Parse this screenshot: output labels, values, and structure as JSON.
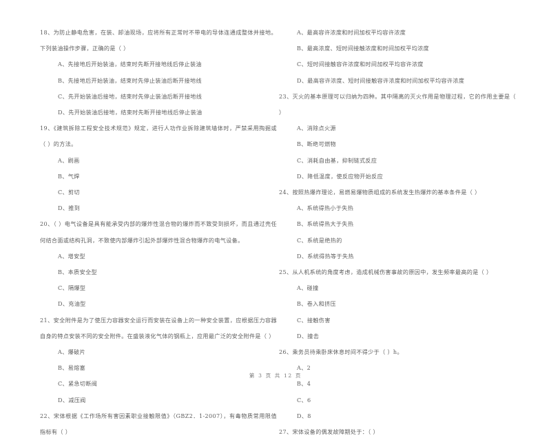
{
  "document": {
    "footer": "第 3 页 共 12 页",
    "page_number": 3,
    "total_pages": 12,
    "text_color": "#5e5e5e",
    "background_color": "#ffffff"
  },
  "left_column": {
    "questions": [
      {
        "number": "18",
        "stem": "18、为防止静电危害，在装、卸油现场，应将所有正常时不带电的导体连通成整体并接地。下列装油操作步骤，正确的是（      ）",
        "options": [
          "A、先接地后开始装油，结束时先断开接地线后停止装油",
          "B、先接地后开始装油，结束时先停止装油后断开接地线",
          "C、先开始装油后接地，结束时先停止装油后断开接地线",
          "D、先开始装油后接地，结束时先断开接地线后停止装油"
        ]
      },
      {
        "number": "19",
        "stem": "19、《建筑拆除工程安全技术规范》规定，进行人功作业拆除建筑墙体时，严禁采用掏掘或（      ）的方法。",
        "options": [
          "A、刷画",
          "B、气焊",
          "C、剪切",
          "D、推到"
        ]
      },
      {
        "number": "20",
        "stem": "20、（      ）电气设备是具有能承受内部的爆炸性混合物的爆炸而不致受到损坏，而且通过壳任何结合面或结构孔洞，不致使内部爆炸引起外部爆炸性混合物爆炸的电气设备。",
        "options": [
          "A、增安型",
          "B、本质安全型",
          "C、隔爆型",
          "D、充油型"
        ]
      },
      {
        "number": "21",
        "stem": "21、安全附件是为了使压力容器安全运行而安装在设备上的一种安全装置，应根据压力容器自身的特点安装不同的安全附件。在盛装液化气体的钢瓶上，应用最广泛的安全附件是（      ）",
        "options": [
          "A、爆破片",
          "B、易熔塞",
          "C、紧急切断阀",
          "D、减压阀"
        ]
      },
      {
        "number": "22",
        "stem": "22、宋体根据《工作场所有害因素职业接触限值》（GBZ2．1-2007），有毒物质常用限值指标有（      ）",
        "options": []
      }
    ]
  },
  "right_column": {
    "questions": [
      {
        "number": "22-options",
        "stem": "",
        "options": [
          "A、最高容许浓度和时间加权平均容许浓度",
          "B、最高浓度、短时间接触浓度和时间加权平均浓度",
          "C、短时间接触容许浓度和时间加权平均容许浓度",
          "D、最高容许浓度、短时间接触容许浓度和时间加权平均容许浓度"
        ]
      },
      {
        "number": "23",
        "stem": "23、灭火的基本原理可以归纳为四种。其中隔离的灭火作用是物理过程，它的作用主要是（      ）",
        "options": [
          "A、消除点火源",
          "B、断绝可燃物",
          "C、消耗自由基，抑制链式反应",
          "D、降低温度，使反应物开始反应"
        ]
      },
      {
        "number": "24",
        "stem": "24、按照热爆炸理论，易燃易爆物质组成的系统发生热爆炸的基本条件是（      ）",
        "options": [
          "A、系统得热小于失热",
          "B、系统得热大于失热",
          "C、系统是绝热的",
          "D、系统得热等于失热"
        ]
      },
      {
        "number": "25",
        "stem": "25、从人机系统的角度考虑，造成机械伤害事故的原因中，发生频率最高的是（      ）",
        "options": [
          "A、碰撞",
          "B、卷入和挤压",
          "C、接触伤害",
          "D、撞击"
        ]
      },
      {
        "number": "26",
        "stem": "26、乘务员待乘卧床休息时间不得少于（      ）h。",
        "options": [
          "A、2",
          "B、4",
          "C、6",
          "D、8"
        ]
      },
      {
        "number": "27",
        "stem": "27、宋体设备的偶发故障期处于：（      ）",
        "options": []
      }
    ]
  }
}
